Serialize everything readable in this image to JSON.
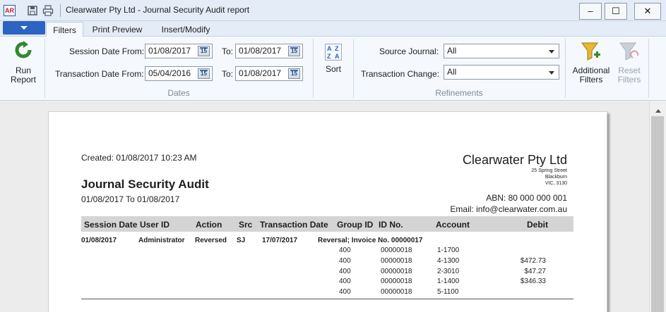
{
  "window": {
    "app_badge": "AR",
    "title": "Clearwater Pty Ltd - Journal Security Audit report",
    "minimize": "–",
    "maximize": "☐",
    "close": "✕"
  },
  "tabs": [
    {
      "label": "Filters",
      "active": true
    },
    {
      "label": "Print Preview",
      "active": false
    },
    {
      "label": "Insert/Modify",
      "active": false
    }
  ],
  "ribbon": {
    "run_report": {
      "line1": "Run",
      "line2": "Report"
    },
    "dates": {
      "session_from_label": "Session Date From:",
      "session_from_value": "01/08/2017",
      "session_to_label": "To:",
      "session_to_value": "01/08/2017",
      "transaction_from_label": "Transaction Date From:",
      "transaction_from_value": "05/04/2016",
      "transaction_to_label": "To:",
      "transaction_to_value": "01/08/2017",
      "calendar_glyph": "15",
      "group_label": "Dates"
    },
    "sort": {
      "label": "Sort"
    },
    "refinements": {
      "source_journal_label": "Source Journal:",
      "source_journal_value": "All",
      "transaction_change_label": "Transaction Change:",
      "transaction_change_value": "All",
      "group_label": "Refinements"
    },
    "additional_filters": {
      "line1": "Additional",
      "line2": "Filters"
    },
    "reset_filters": {
      "line1": "Reset",
      "line2": "Filters"
    }
  },
  "report": {
    "created": "Created: 01/08/2017 10:23 AM",
    "title": "Journal Security Audit",
    "period": "01/08/2017 To 01/08/2017",
    "company": {
      "name": "Clearwater Pty Ltd",
      "address1": "25 Spring Street",
      "address2": "Blackburn",
      "address3": "VIC, 3130",
      "abn": "ABN: 80 000 000 001",
      "email": "Email: info@clearwater.com.au"
    },
    "columns": [
      "Session Date",
      "User ID",
      "Action",
      "Src",
      "Transaction Date",
      "Group ID",
      "ID No.",
      "Account",
      "Debit"
    ],
    "entry": {
      "session_date": "01/08/2017",
      "user_id": "Administrator",
      "action": "Reversed",
      "src": "SJ",
      "transaction_date": "17/07/2017",
      "description": "Reversal; Invoice No. 00000017"
    },
    "lines": [
      {
        "group_id": "400",
        "id_no": "00000018",
        "account": "1-1700",
        "debit": ""
      },
      {
        "group_id": "400",
        "id_no": "00000018",
        "account": "4-1300",
        "debit": "$472.73"
      },
      {
        "group_id": "400",
        "id_no": "00000018",
        "account": "2-3010",
        "debit": "$47.27"
      },
      {
        "group_id": "400",
        "id_no": "00000018",
        "account": "1-1400",
        "debit": "$346.33"
      },
      {
        "group_id": "400",
        "id_no": "00000018",
        "account": "5-1100",
        "debit": ""
      }
    ]
  }
}
